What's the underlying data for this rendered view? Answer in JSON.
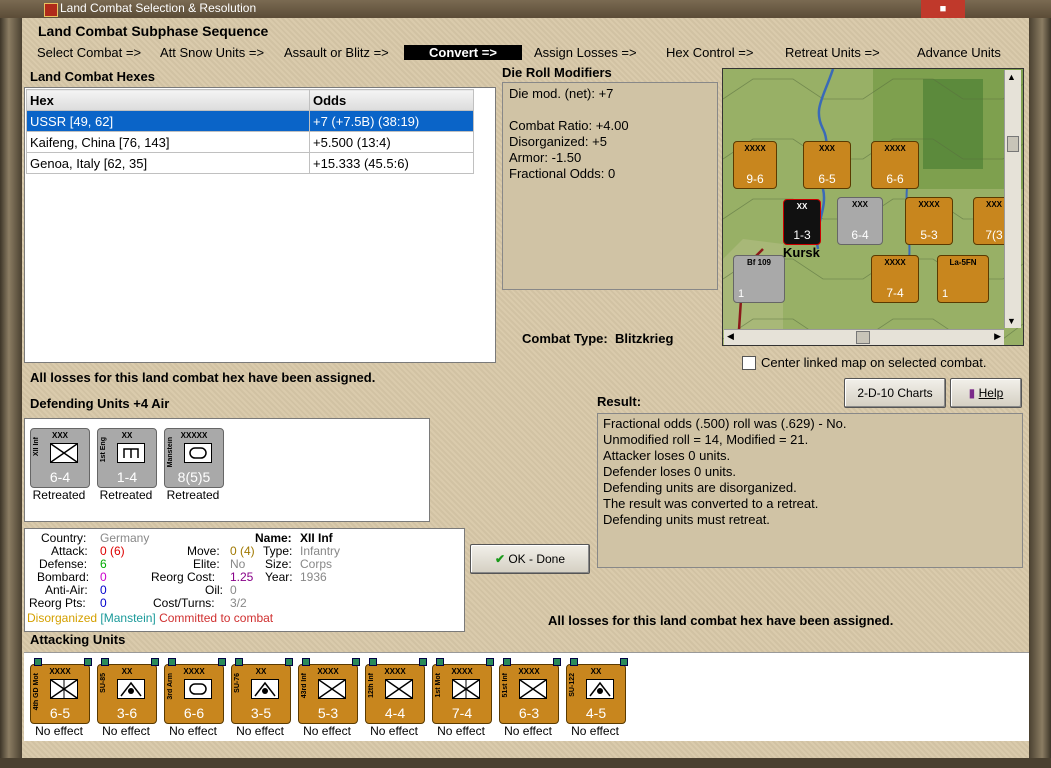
{
  "window": {
    "title": "Land Combat Selection & Resolution"
  },
  "subphase": {
    "title": "Land Combat Subphase Sequence",
    "steps": [
      "Select Combat =>",
      "Att Snow Units =>",
      "Assault or Blitz =>",
      "Convert =>",
      "Assign Losses =>",
      "Hex Control =>",
      "Retreat Units =>",
      "Advance Units"
    ],
    "active_index": 3
  },
  "hexes": {
    "title": "Land Combat Hexes",
    "headers": [
      "Hex",
      "Odds"
    ],
    "rows": [
      {
        "hex": "USSR [49, 62]",
        "odds": "+7 (+7.5B) (38:19)"
      },
      {
        "hex": "Kaifeng, China [76, 143]",
        "odds": "+5.500 (13:4)"
      },
      {
        "hex": "Genoa, Italy [62, 35]",
        "odds": "+15.333 (45.5:6)"
      }
    ],
    "selected": 0
  },
  "modifiers": {
    "title": "Die Roll Modifiers",
    "lines": [
      "Die mod. (net): +7",
      "",
      "Combat Ratio: +4.00",
      "Disorganized: +5",
      "Armor: -1.50",
      "Fractional Odds: 0"
    ]
  },
  "combat_type": {
    "label": "Combat Type:",
    "value": "Blitzkrieg"
  },
  "map": {
    "center_label": "Center linked map on selected combat.",
    "place_label": "Kursk",
    "counters": [
      {
        "val": "9-6",
        "size": "XXXX"
      },
      {
        "val": "6-5",
        "size": "XXX"
      },
      {
        "val": "6-6",
        "size": "XXXX"
      },
      {
        "val": "1-3",
        "size": "XX"
      },
      {
        "val": "6-4",
        "size": "XXX"
      },
      {
        "val": "5-3",
        "size": "XXXX"
      },
      {
        "val": "7(3",
        "size": "XXX"
      },
      {
        "val": "7-4",
        "size": "XXXX"
      },
      {
        "val": "1",
        "size": "",
        "name": "Bf 109"
      },
      {
        "val": "1",
        "size": "",
        "name": "La-5FN"
      }
    ]
  },
  "losses_msg_top": "All losses for this land combat hex have been assigned.",
  "losses_msg_bottom": "All losses for this land combat hex have been assigned.",
  "defending": {
    "title": "Defending Units +4 Air",
    "units": [
      {
        "name": "XII Inf",
        "size": "XXX",
        "val": "6-4",
        "status": "Retreated",
        "kind": "inf"
      },
      {
        "name": "1st Eng",
        "size": "XX",
        "val": "1-4",
        "status": "Retreated",
        "kind": "eng"
      },
      {
        "name": "Manstein",
        "size": "XXXXX",
        "val": "8(5)5",
        "status": "Retreated",
        "kind": "hq"
      }
    ]
  },
  "buttons": {
    "charts": "2-D-10 Charts",
    "help": "Help",
    "done": "OK - Done"
  },
  "result": {
    "title": "Result:",
    "lines": [
      "Fractional odds (.500) roll was (.629)  - No.",
      "Unmodified roll = 14, Modified = 21.",
      "Attacker loses 0 units.",
      "Defender loses 0 units.",
      "Defending units are disorganized.",
      "The result was converted to a retreat.",
      "Defending units must retreat."
    ]
  },
  "info": {
    "country_l": "Country:",
    "country": "Germany",
    "name_l": "Name:",
    "name": "XII Inf",
    "attack_l": "Attack:",
    "attack": "0 (6)",
    "move_l": "Move:",
    "move": "0 (4)",
    "type_l": "Type:",
    "type": "Infantry",
    "defense_l": "Defense:",
    "defense": "6",
    "elite_l": "Elite:",
    "elite": "No",
    "size_l": "Size:",
    "size": "Corps",
    "bombard_l": "Bombard:",
    "bombard": "0",
    "reorg_l": "Reorg Cost:",
    "reorg": "1.25",
    "year_l": "Year:",
    "year": "1936",
    "aa_l": "Anti-Air:",
    "aa": "0",
    "oil_l": "Oil:",
    "oil": "0",
    "rp_l": "Reorg Pts:",
    "rp": "0",
    "ct_l": "Cost/Turns:",
    "ct": "3/2",
    "status1": "Disorganized",
    "status2": "[Manstein]",
    "status3": "Committed to combat"
  },
  "attacking": {
    "title": "Attacking Units",
    "units": [
      {
        "name": "4th GD Mot",
        "size": "XXXX",
        "val": "6-5",
        "status": "No effect",
        "kind": "mot"
      },
      {
        "name": "SU-85",
        "size": "XX",
        "val": "3-6",
        "status": "No effect",
        "kind": "at"
      },
      {
        "name": "3rd Arm",
        "size": "XXXX",
        "val": "6-6",
        "status": "No effect",
        "kind": "arm"
      },
      {
        "name": "SU-76",
        "size": "XX",
        "val": "3-5",
        "status": "No effect",
        "kind": "at"
      },
      {
        "name": "43rd Inf",
        "size": "XXXX",
        "val": "5-3",
        "status": "No effect",
        "kind": "inf"
      },
      {
        "name": "12th Inf",
        "size": "XXXX",
        "val": "4-4",
        "status": "No effect",
        "kind": "inf"
      },
      {
        "name": "1st Mot",
        "size": "XXXX",
        "val": "7-4",
        "status": "No effect",
        "kind": "mot"
      },
      {
        "name": "51st Inf",
        "size": "XXXX",
        "val": "6-3",
        "status": "No effect",
        "kind": "inf"
      },
      {
        "name": "SU-122",
        "size": "XX",
        "val": "4-5",
        "status": "No effect",
        "kind": "at"
      }
    ]
  }
}
